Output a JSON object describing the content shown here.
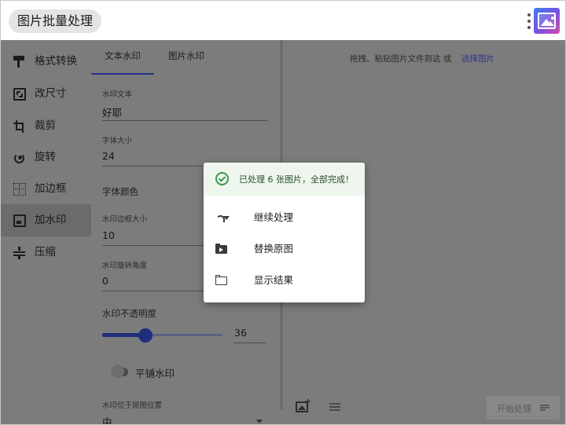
{
  "header": {
    "title": "图片批量处理",
    "app_icon": "image-gallery-icon"
  },
  "sidebar": {
    "items": [
      {
        "label": "格式转换",
        "icon": "paint-brush-icon"
      },
      {
        "label": "改尺寸",
        "icon": "resize-icon"
      },
      {
        "label": "裁剪",
        "icon": "crop-icon"
      },
      {
        "label": "旋转",
        "icon": "rotate-icon"
      },
      {
        "label": "加边框",
        "icon": "border-icon"
      },
      {
        "label": "加水印",
        "icon": "watermark-icon",
        "active": true
      },
      {
        "label": "压缩",
        "icon": "compress-icon"
      }
    ]
  },
  "tabs": [
    {
      "label": "文本水印",
      "active": true
    },
    {
      "label": "图片水印",
      "active": false
    }
  ],
  "form": {
    "text_label": "水印文本",
    "text_value": "好耶",
    "size_label": "字体大小",
    "size_value": "24",
    "color_label": "字体颜色",
    "margin_label": "水印边框大小",
    "margin_value": "10",
    "angle_label": "水印旋转角度",
    "angle_value": "0",
    "opacity_label": "水印不透明度",
    "opacity_value": "36",
    "opacity_level": 0.36,
    "tile_label": "平铺水印",
    "tile_on": false,
    "position_label": "水印位于原图位置",
    "position_value": "中"
  },
  "drop": {
    "text": "拖拽、粘贴图片文件到这 或",
    "link": "选择图片"
  },
  "bottom": {
    "start_label": "开始处理"
  },
  "dialog": {
    "message": "已处理 6 张图片，全部完成！",
    "items": [
      {
        "label": "继续处理",
        "icon": "redo-icon"
      },
      {
        "label": "替换原图",
        "icon": "folder-move-icon"
      },
      {
        "label": "显示结果",
        "icon": "folder-icon"
      }
    ]
  },
  "colors": {
    "accent": "#24368e",
    "success": "#3a9a4a",
    "overlay": "#7c7c7c"
  }
}
